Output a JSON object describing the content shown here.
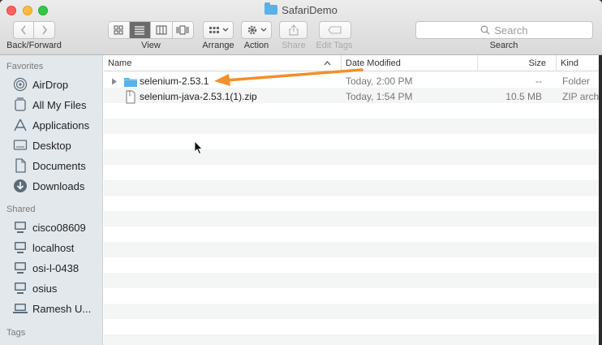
{
  "window": {
    "title": "SafariDemo"
  },
  "toolbar": {
    "back_forward_label": "Back/Forward",
    "view_label": "View",
    "arrange_label": "Arrange",
    "action_label": "Action",
    "share_label": "Share",
    "edit_tags_label": "Edit Tags",
    "search_placeholder": "Search",
    "search_label": "Search"
  },
  "sidebar": {
    "favorites_heading": "Favorites",
    "favorites": [
      {
        "label": "AirDrop",
        "icon": "airdrop-icon"
      },
      {
        "label": "All My Files",
        "icon": "all-files-icon"
      },
      {
        "label": "Applications",
        "icon": "applications-icon"
      },
      {
        "label": "Desktop",
        "icon": "desktop-icon"
      },
      {
        "label": "Documents",
        "icon": "documents-icon"
      },
      {
        "label": "Downloads",
        "icon": "downloads-icon"
      }
    ],
    "shared_heading": "Shared",
    "shared": [
      {
        "label": "cisco08609",
        "icon": "computer-icon"
      },
      {
        "label": "localhost",
        "icon": "computer-icon"
      },
      {
        "label": "osi-l-0438",
        "icon": "computer-icon"
      },
      {
        "label": "osius",
        "icon": "computer-icon"
      },
      {
        "label": "Ramesh U...",
        "icon": "computer-icon"
      }
    ],
    "tags_heading": "Tags"
  },
  "columns": {
    "name": "Name",
    "date_modified": "Date Modified",
    "size": "Size",
    "kind": "Kind"
  },
  "files": [
    {
      "name": "selenium-2.53.1",
      "date": "Today, 2:00 PM",
      "size": "--",
      "kind": "Folder",
      "icon": "folder-icon"
    },
    {
      "name": "selenium-java-2.53.1(1).zip",
      "date": "Today, 1:54 PM",
      "size": "10.5 MB",
      "kind": "ZIP arch",
      "icon": "zip-file-icon"
    }
  ],
  "colors": {
    "accent": "#3a8ee6",
    "folder": "#5ab0e8",
    "arrow": "#f0902a"
  }
}
